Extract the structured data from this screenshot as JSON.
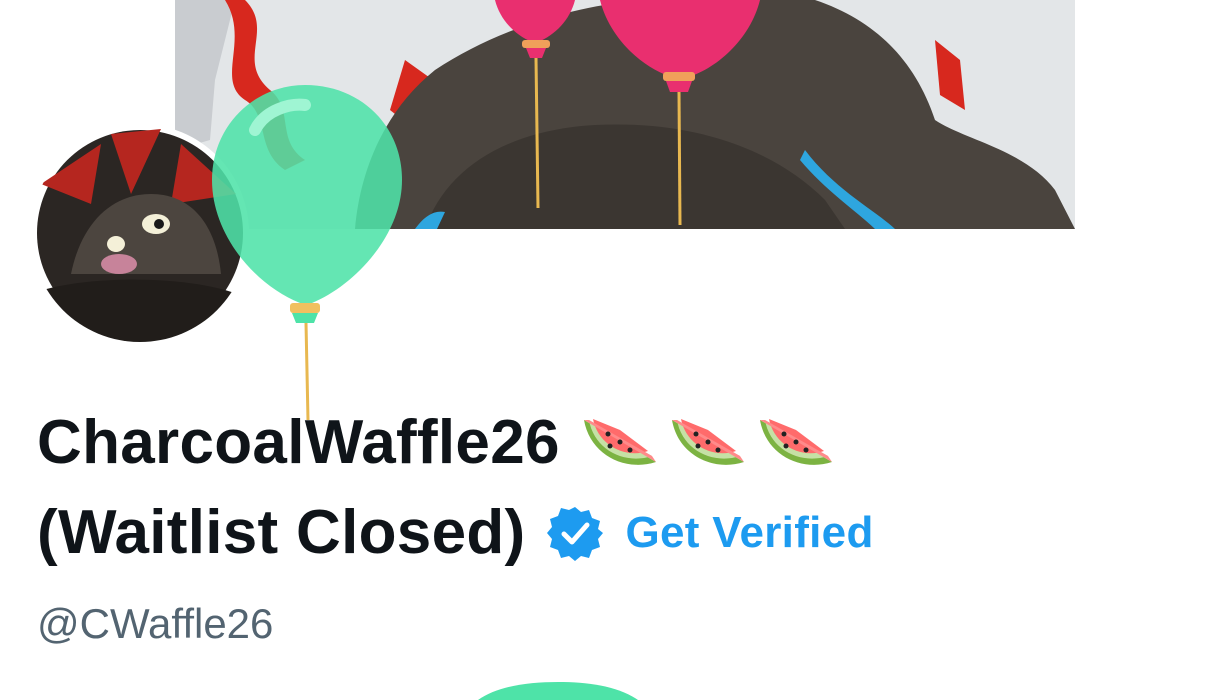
{
  "profile": {
    "display_name_line1": "CharcoalWaffle26",
    "display_name_line2": "(Waitlist Closed)",
    "name_emojis": [
      "watermelon",
      "watermelon",
      "watermelon"
    ],
    "verified_link_label": "Get Verified",
    "handle": "@CWaffle26"
  },
  "colors": {
    "accent": "#1d9bf0",
    "name_text": "#0f1419",
    "handle_text": "#536471",
    "balloon_green": "#4ee3a8",
    "balloon_pink": "#e92f6f"
  },
  "icons": {
    "badge": "verified-badge-icon",
    "emoji": "watermelon-icon",
    "balloon": "balloon-icon"
  }
}
